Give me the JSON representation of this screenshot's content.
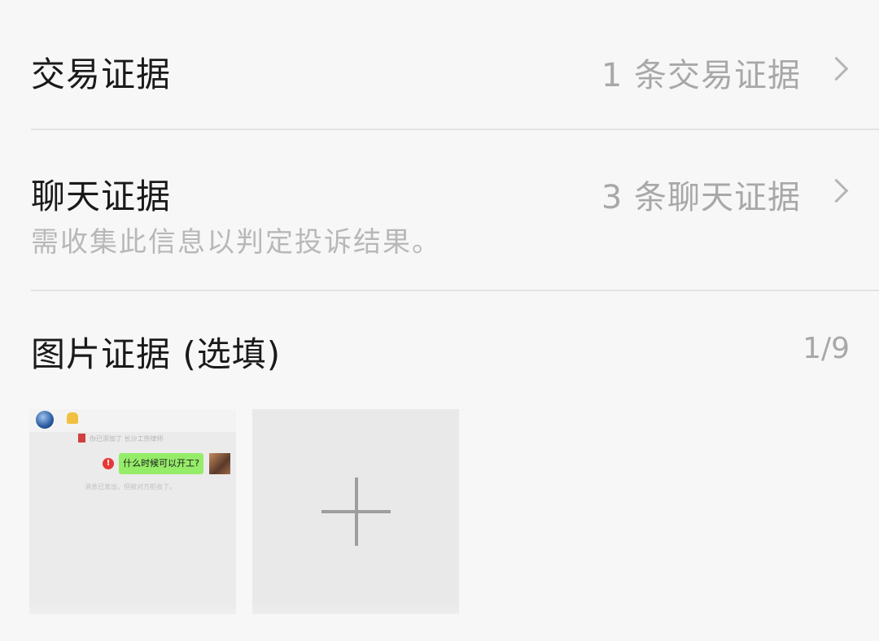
{
  "transaction_evidence": {
    "label": "交易证据",
    "value": "1 条交易证据"
  },
  "chat_evidence": {
    "label": "聊天证据",
    "value": "3 条聊天证据",
    "hint": "需收集此信息以判定投诉结果。"
  },
  "image_evidence": {
    "label": "图片证据 (选填)",
    "counter": "1/9",
    "thumbnail": {
      "notice_text": "你已添加了 长沙工伤律师",
      "message": "什么时候可以开工?",
      "system_text": "消息已发出，但被对方拒收了。"
    }
  },
  "icons": {
    "chevron": "chevron-right-icon",
    "add": "plus-icon",
    "error": "error-icon"
  },
  "colors": {
    "bubble_green": "#95ec69",
    "error_red": "#e53935",
    "secondary_text": "#a8a8a8"
  }
}
